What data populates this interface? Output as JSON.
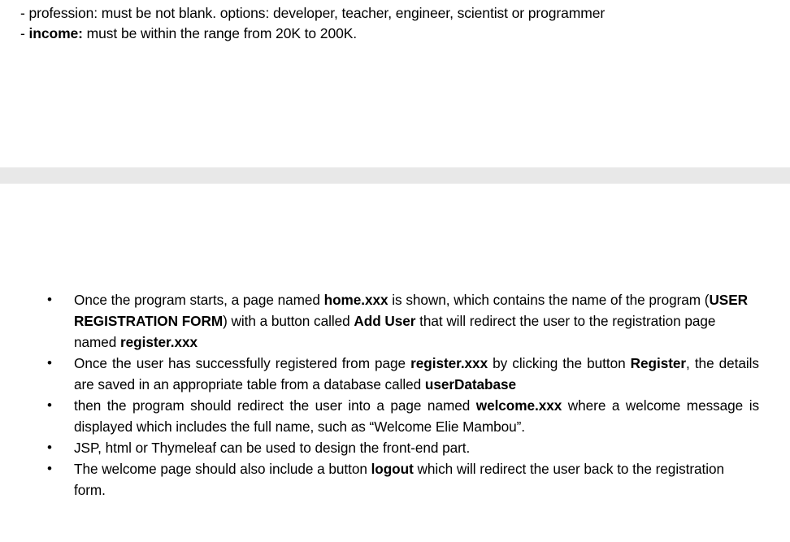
{
  "document": {
    "background_color": "#ffffff",
    "text_color": "#000000",
    "separator_color": "#e8e8e8"
  },
  "top_fragment": {
    "spec_lines": [
      {
        "marker": "-",
        "label": "profession:",
        "label_bold": false,
        "text": " profession: must be not blank. options: developer, teacher, engineer, scientist or programmer"
      },
      {
        "marker": "-",
        "label": "income:",
        "label_bold": true,
        "text": " must be within the range from 20K to 200K."
      }
    ],
    "line1_full": "- profession: must be not blank. options: developer, teacher, engineer, scientist or programmer",
    "line2_prefix": "- ",
    "line2_bold": "income:",
    "line2_rest": " must be within the range from 20K to 200K."
  },
  "bottom_fragment": {
    "bullet_marker": "•",
    "bullets": [
      {
        "id": "bullet-home-page",
        "justified": false,
        "parts": [
          {
            "text": "Once the program starts, a page named ",
            "bold": false
          },
          {
            "text": "home.xxx",
            "bold": true
          },
          {
            "text": " is shown, which contains the name of the program (",
            "bold": false
          },
          {
            "text": "USER REGISTRATION FORM",
            "bold": true
          },
          {
            "text": ") with a button called ",
            "bold": false
          },
          {
            "text": "Add User",
            "bold": true
          },
          {
            "text": " that will redirect the user to the registration page named ",
            "bold": false
          },
          {
            "text": "register.xxx",
            "bold": true
          }
        ]
      },
      {
        "id": "bullet-register-page",
        "justified": true,
        "parts": [
          {
            "text": "Once the user has successfully registered from page ",
            "bold": false
          },
          {
            "text": "register.xxx",
            "bold": true
          },
          {
            "text": " by clicking the button ",
            "bold": false
          },
          {
            "text": "Register",
            "bold": true
          },
          {
            "text": ", the details are saved in an appropriate table from a database called ",
            "bold": false
          },
          {
            "text": "userDatabase",
            "bold": true
          }
        ]
      },
      {
        "id": "bullet-welcome-page",
        "justified": true,
        "parts": [
          {
            "text": "then the program should redirect the user into a page named ",
            "bold": false
          },
          {
            "text": "welcome.xxx",
            "bold": true
          },
          {
            "text": " where a welcome message is displayed which includes the full name, such as “Welcome Elie Mambou”.",
            "bold": false
          }
        ]
      },
      {
        "id": "bullet-frontend-tech",
        "justified": false,
        "parts": [
          {
            "text": " JSP, html or Thymeleaf can be used to design the front-end part.",
            "bold": false
          }
        ]
      },
      {
        "id": "bullet-logout-button",
        "justified": false,
        "parts": [
          {
            "text": "The welcome page should also include a button ",
            "bold": false
          },
          {
            "text": "logout",
            "bold": true
          },
          {
            "text": " which will redirect the user back to the registration form.",
            "bold": false
          }
        ]
      }
    ]
  }
}
